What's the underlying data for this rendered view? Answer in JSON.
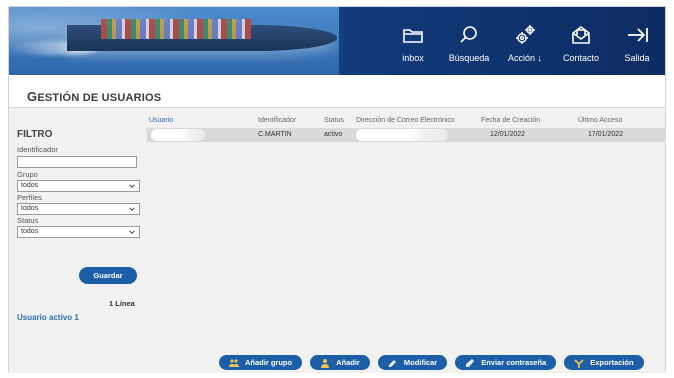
{
  "header": {
    "nav": [
      {
        "label": "inbox",
        "icon": "inbox-folder-icon"
      },
      {
        "label": "Búsqueda",
        "icon": "search-icon"
      },
      {
        "label": "Acción ↓",
        "icon": "gears-icon"
      },
      {
        "label": "Contacto",
        "icon": "envelope-icon"
      },
      {
        "label": "Salida",
        "icon": "exit-arrow-icon"
      }
    ]
  },
  "page": {
    "title_first": "G",
    "title_rest": "ESTIÓN DE USUARIOS"
  },
  "filter": {
    "heading": "FILTRO",
    "identificador_label": "Identificador",
    "identificador_value": "",
    "grupo_label": "Grupo",
    "grupo_value": "todos",
    "perfiles_label": "Perfiles",
    "perfiles_value": "todos",
    "status_label": "Status",
    "status_value": "todos",
    "save_label": "Guardar",
    "line_count": "1 Línea",
    "active_users": "Usuario activo 1"
  },
  "table": {
    "headers": [
      "Usuario",
      "Identificador",
      "Status",
      "Dirección de Correo Electrónico",
      "Fecha de Creación",
      "Último Acceso"
    ],
    "rows": [
      {
        "usuario": "",
        "identificador": "C.MARTIN",
        "status": "activo",
        "email": "",
        "creacion": "12/01/2022",
        "acceso": "17/01/2022"
      }
    ]
  },
  "actions": [
    {
      "label": "Añadir grupo",
      "icon": "group-add-icon"
    },
    {
      "label": "Añadir",
      "icon": "user-add-icon"
    },
    {
      "label": "Modificar",
      "icon": "edit-icon"
    },
    {
      "label": "Enviar contraseña",
      "icon": "send-password-icon"
    },
    {
      "label": "Exportación",
      "icon": "export-icon"
    }
  ],
  "colors": {
    "header_dark": "#0d2c63",
    "button_blue": "#1c5fa8",
    "link_blue": "#2a6fb5",
    "row_selected": "#dadada"
  }
}
